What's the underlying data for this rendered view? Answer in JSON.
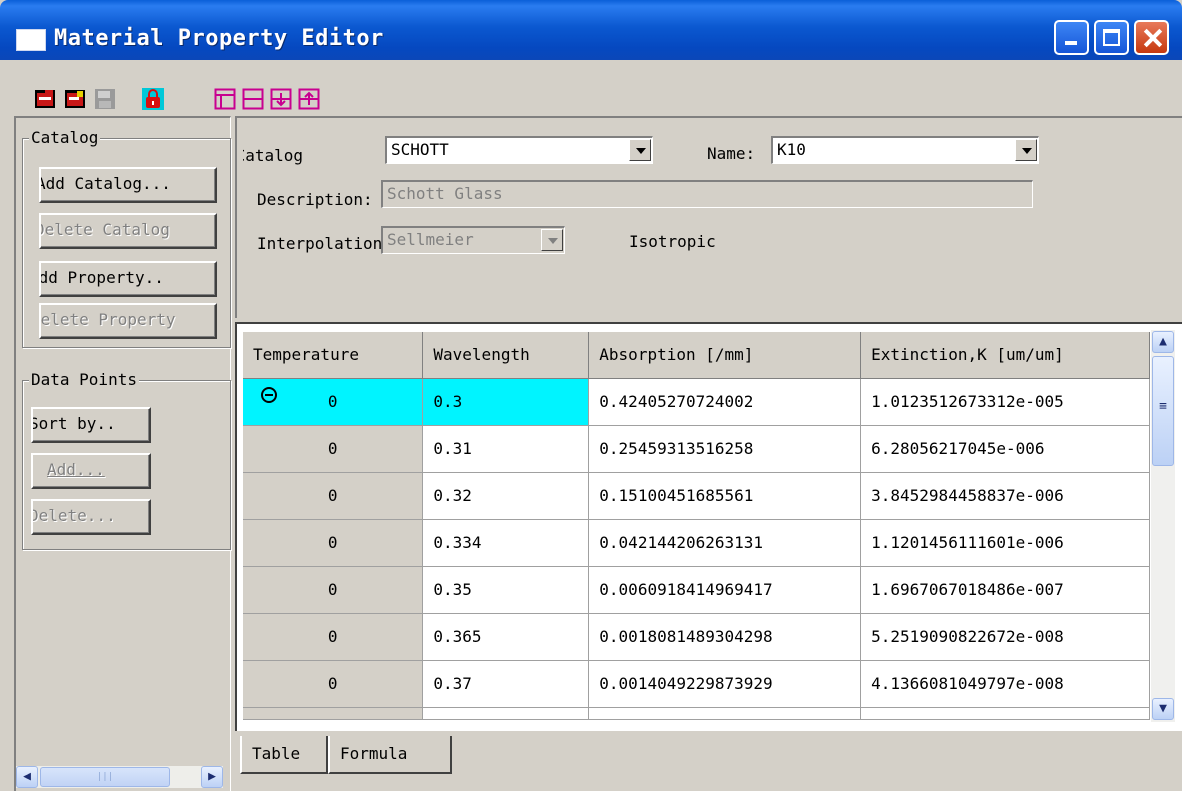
{
  "window": {
    "title": "Material Property Editor"
  },
  "toolbar": {
    "icons": [
      "open-icon",
      "edit-icon",
      "save-icon",
      "lock-icon",
      "table-icon",
      "split-icon",
      "insert-row-icon",
      "delete-row-icon"
    ]
  },
  "catalog_group": {
    "title": "Catalog",
    "add_catalog": "Add Catalog...",
    "delete_catalog": "Delete Catalog",
    "add_property": "Add Property..",
    "delete_property": "Delete Property"
  },
  "data_points_group": {
    "title": "Data Points",
    "sort_by": "Sort by..",
    "add": "Add...",
    "delete": "Delete..."
  },
  "properties": {
    "catalog_label": "Catalog:",
    "catalog_value": "SCHOTT",
    "name_label": "Name:",
    "name_value": "K10",
    "description_label": "Description:",
    "description_value": "Schott Glass",
    "interpolation_label": "Interpolation:",
    "interpolation_value": "Sellmeier",
    "anisotropy": "Isotropic"
  },
  "table": {
    "columns": [
      "Temperature",
      "Wavelength",
      "Absorption [/mm]",
      "Extinction,K [um/um]"
    ],
    "rows": [
      [
        "0",
        "0.3",
        "0.42405270724002",
        "1.0123512673312e-005"
      ],
      [
        "0",
        "0.31",
        "0.25459313516258",
        "6.28056217045e-006"
      ],
      [
        "0",
        "0.32",
        "0.15100451685561",
        "3.8452984458837e-006"
      ],
      [
        "0",
        "0.334",
        "0.042144206263131",
        "1.1201456111601e-006"
      ],
      [
        "0",
        "0.35",
        "0.0060918414969417",
        "1.6967067018486e-007"
      ],
      [
        "0",
        "0.365",
        "0.0018081489304298",
        "5.2519090822672e-008"
      ],
      [
        "0",
        "0.37",
        "0.0014049229873929",
        "4.1366081049797e-008"
      ]
    ]
  },
  "tabs": {
    "table": "Table",
    "formula": "Formula"
  },
  "colors": {
    "titlebar": "#0b58d0",
    "selected_row": "#00f4ff"
  }
}
